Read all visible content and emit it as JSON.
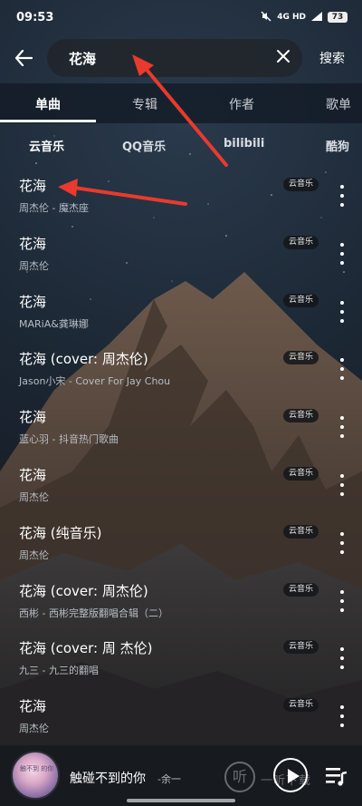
{
  "status_bar": {
    "time": "09:53",
    "network": "4G HD",
    "battery": "73"
  },
  "search": {
    "query": "花海",
    "button_label": "搜索"
  },
  "tabs": [
    {
      "label": "单曲",
      "active": true
    },
    {
      "label": "专辑",
      "active": false
    },
    {
      "label": "作者",
      "active": false
    },
    {
      "label": "歌单",
      "active": false
    }
  ],
  "sources": [
    {
      "label": "云音乐",
      "active": true
    },
    {
      "label": "QQ音乐",
      "active": false
    },
    {
      "label": "bilibili",
      "active": false
    },
    {
      "label": "酷狗",
      "active": false
    }
  ],
  "songs": [
    {
      "title": "花海",
      "subtitle": "周杰伦 - 魔杰座",
      "badge": "云音乐"
    },
    {
      "title": "花海",
      "subtitle": "周杰伦",
      "badge": "云音乐"
    },
    {
      "title": "花海",
      "subtitle": "MARiA&龚琳娜",
      "badge": "云音乐"
    },
    {
      "title": "花海 (cover: 周杰伦)",
      "subtitle": "Jason小宋 - Cover For Jay Chou",
      "badge": "云音乐"
    },
    {
      "title": "花海",
      "subtitle": "蓝心羽 - 抖音热门歌曲",
      "badge": "云音乐"
    },
    {
      "title": "花海",
      "subtitle": "周杰伦",
      "badge": "云音乐"
    },
    {
      "title": "花海 (纯音乐)",
      "subtitle": "周杰伦",
      "badge": "云音乐"
    },
    {
      "title": "花海 (cover: 周杰伦)",
      "subtitle": "西彬 - 西彬完整版翻唱合辑（二）",
      "badge": "云音乐"
    },
    {
      "title": "花海 (cover: 周 杰伦)",
      "subtitle": "九三 - 九三的翻唱",
      "badge": "云音乐"
    },
    {
      "title": "花海",
      "subtitle": "周杰伦",
      "badge": "云音乐"
    }
  ],
  "player": {
    "title": "触碰不到的你",
    "artist": "-余一",
    "cover_text": "触不到 的你"
  },
  "watermark": {
    "glyph": "听",
    "text": "一听下载"
  },
  "colors": {
    "annotation_arrow": "#e83a2e"
  }
}
